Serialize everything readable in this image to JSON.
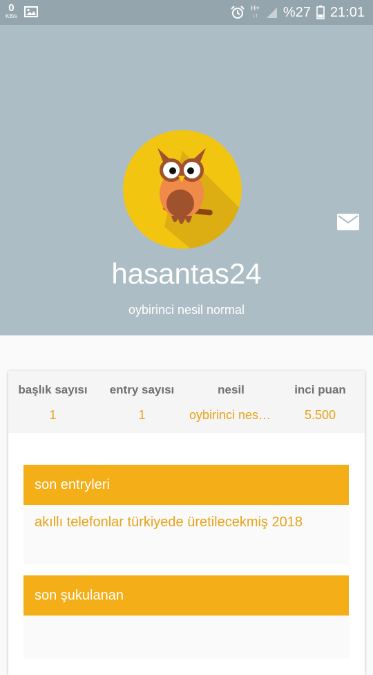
{
  "status_bar": {
    "kbs_value": "0",
    "kbs_unit": "KB/s",
    "network": "H+",
    "battery": "%27",
    "time": "21:01"
  },
  "profile": {
    "username": "hasantas24",
    "subtitle": "oybirinci nesil normal",
    "avatar_icon": "owl-avatar-icon",
    "message_icon": "mail-icon"
  },
  "stats": [
    {
      "label": "başlık sayısı",
      "value": "1"
    },
    {
      "label": "entry sayısı",
      "value": "1"
    },
    {
      "label": "nesil",
      "value": "oybirinci nesil normal"
    },
    {
      "label": "inci puan",
      "value": "5.500"
    }
  ],
  "sections": {
    "recent_entries": {
      "title": "son entryleri",
      "items": [
        "akıllı telefonlar türkiyede üretilecekmiş 2018"
      ]
    },
    "recent_likes": {
      "title": "son şukulanan"
    }
  },
  "colors": {
    "header_bg": "#adbdc5",
    "status_bar_bg": "#95a5ad",
    "accent": "#f4ae18",
    "accent_text": "#e8a317"
  }
}
